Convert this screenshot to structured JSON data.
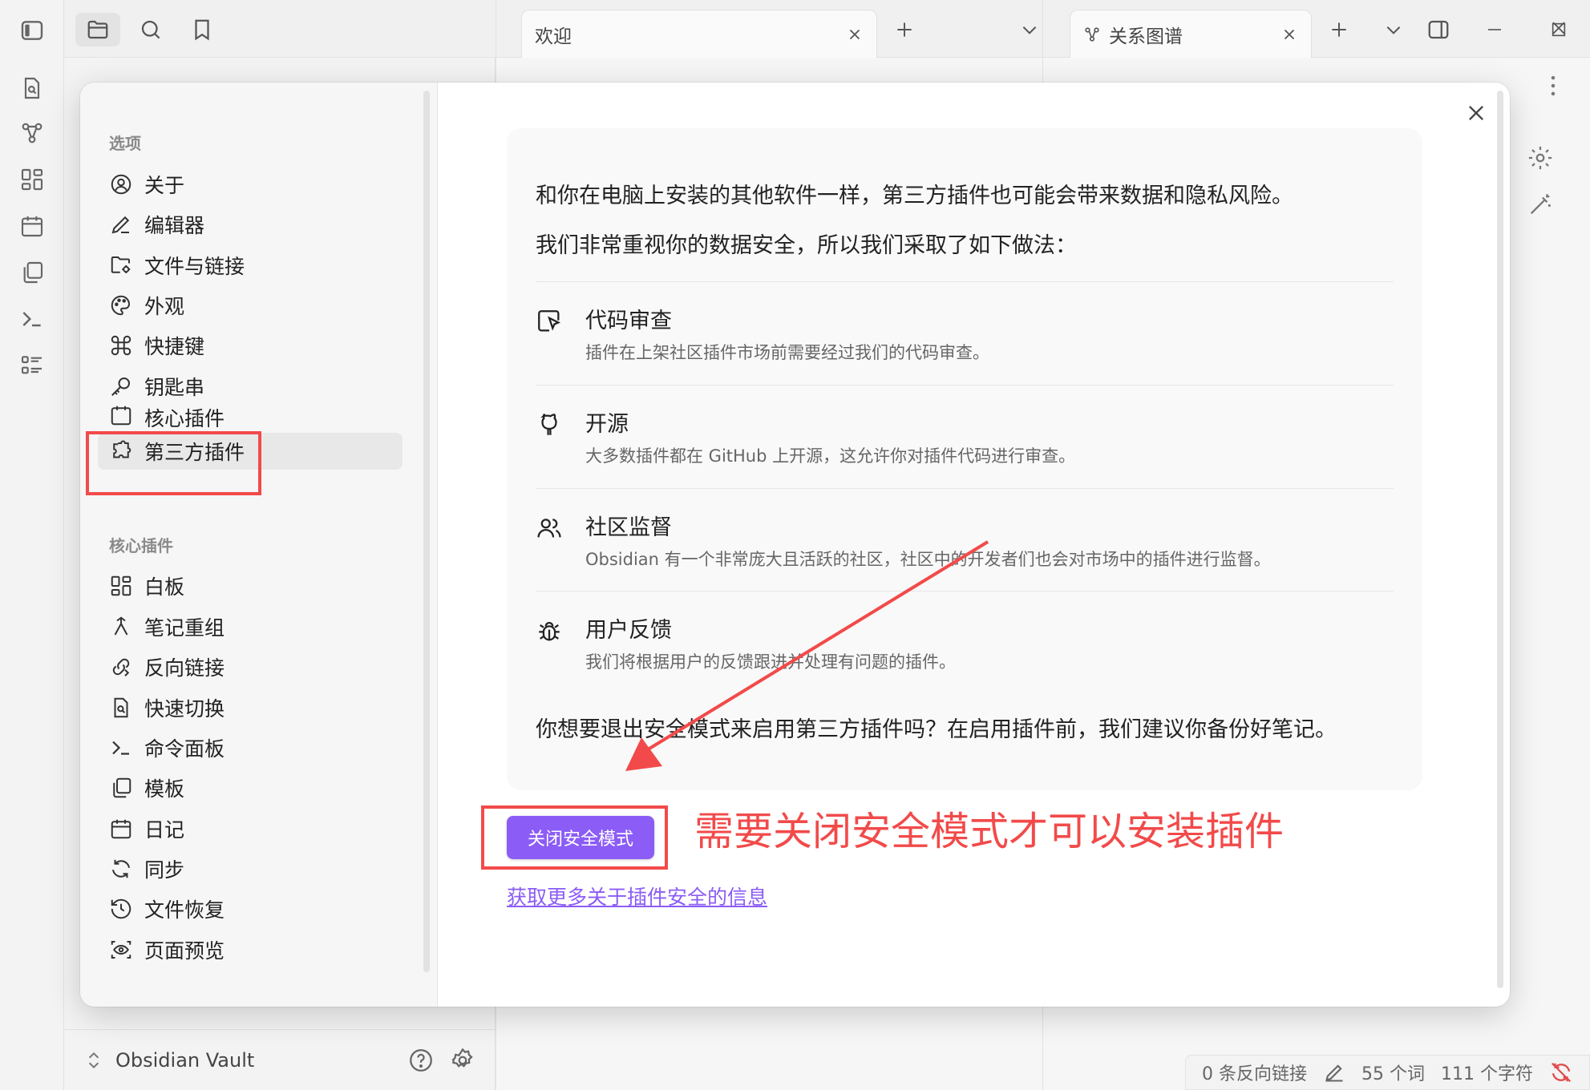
{
  "topbar": {
    "tabs": [
      {
        "label": "欢迎"
      },
      {
        "label": "关系图谱"
      }
    ],
    "pane_headers": [
      "欢迎",
      "关系图谱"
    ]
  },
  "vault": {
    "name": "Obsidian Vault"
  },
  "status": {
    "backlinks": "0 条反向链接",
    "words": "55 个词",
    "chars": "111 个字符"
  },
  "settings_nav": {
    "options_heading": "选项",
    "options": [
      {
        "label": "关于",
        "icon": "user-circle-icon"
      },
      {
        "label": "编辑器",
        "icon": "pencil-icon"
      },
      {
        "label": "文件与链接",
        "icon": "folder-cog-icon"
      },
      {
        "label": "外观",
        "icon": "palette-icon"
      },
      {
        "label": "快捷键",
        "icon": "command-icon"
      },
      {
        "label": "钥匙串",
        "icon": "key-icon"
      },
      {
        "label": "核心插件",
        "icon": "calendar-plugin-icon"
      },
      {
        "label": "第三方插件",
        "icon": "puzzle-icon"
      }
    ],
    "core_heading": "核心插件",
    "core": [
      {
        "label": "白板",
        "icon": "canvas-icon"
      },
      {
        "label": "笔记重组",
        "icon": "merge-icon"
      },
      {
        "label": "反向链接",
        "icon": "backlink-icon"
      },
      {
        "label": "快速切换",
        "icon": "file-search-icon"
      },
      {
        "label": "命令面板",
        "icon": "terminal-icon"
      },
      {
        "label": "模板",
        "icon": "copy-icon"
      },
      {
        "label": "日记",
        "icon": "calendar-icon"
      },
      {
        "label": "同步",
        "icon": "sync-icon"
      },
      {
        "label": "文件恢复",
        "icon": "history-icon"
      },
      {
        "label": "页面预览",
        "icon": "preview-icon"
      }
    ]
  },
  "content": {
    "intro1": "和你在电脑上安装的其他软件一样，第三方插件也可能会带来数据和隐私风险。",
    "intro2": "我们非常重视你的数据安全，所以我们采取了如下做法：",
    "features": [
      {
        "title": "代码审查",
        "desc": "插件在上架社区插件市场前需要经过我们的代码审查。",
        "icon": "code-review-icon"
      },
      {
        "title": "开源",
        "desc": "大多数插件都在 GitHub 上开源，这允许你对插件代码进行审查。",
        "icon": "github-icon"
      },
      {
        "title": "社区监督",
        "desc": "Obsidian 有一个非常庞大且活跃的社区，社区中的开发者们也会对市场中的插件进行监督。",
        "icon": "users-icon"
      },
      {
        "title": "用户反馈",
        "desc": "我们将根据用户的反馈跟进并处理有问题的插件。",
        "icon": "bug-icon"
      }
    ],
    "question": "你想要退出安全模式来启用第三方插件吗？在启用插件前，我们建议你备份好笔记。",
    "button": "关闭安全模式",
    "link": "获取更多关于插件安全的信息"
  },
  "annotation": {
    "text": "需要关闭安全模式才可以安装插件",
    "color": "#f24a4a"
  },
  "colors": {
    "accent": "#8b5cf6"
  }
}
